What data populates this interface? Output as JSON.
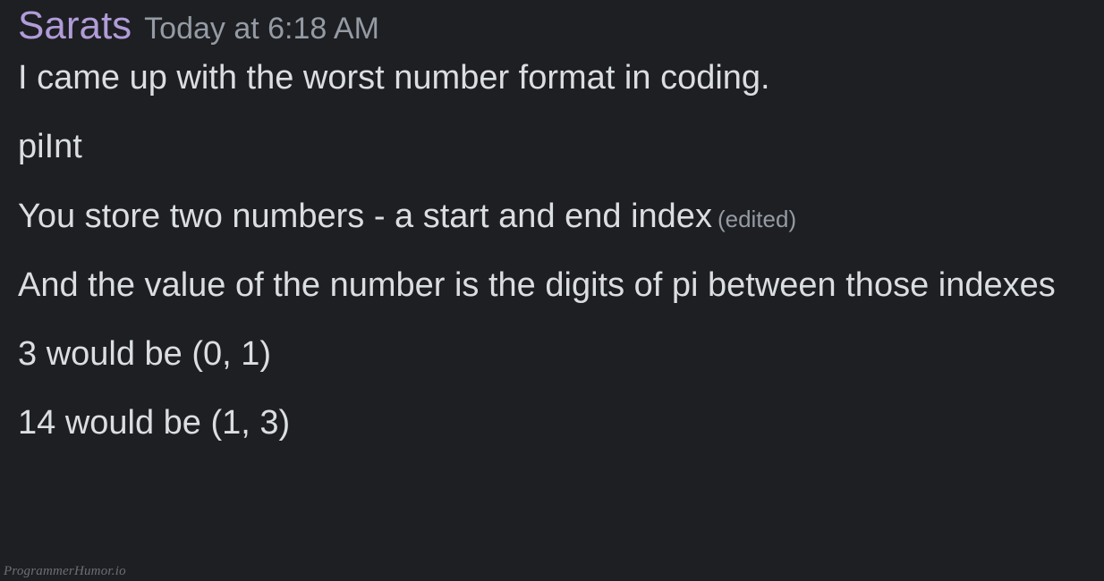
{
  "message": {
    "author": "Sarats",
    "timestamp": "Today at 6:18 AM",
    "lines": {
      "l1": "I came up with the worst number format in coding.",
      "l2": "piInt",
      "l3": "You store two numbers - a start and end index",
      "l4": "And the value of the number is the digits of pi between those indexes",
      "l5": "3 would be (0, 1)",
      "l6": "14 would be (1, 3)"
    },
    "edited_label": "(edited)"
  },
  "watermark": "ProgrammerHumor.io"
}
